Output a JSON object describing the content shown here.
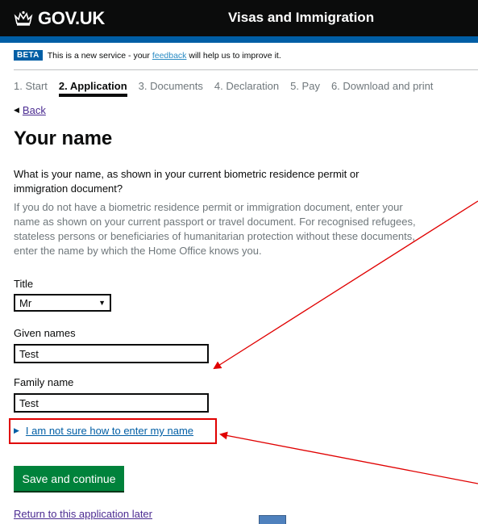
{
  "header": {
    "logo_text": "GOV.UK",
    "service_name": "Visas and Immigration"
  },
  "beta_banner": {
    "tag": "BETA",
    "text_before": "This is a new service - your ",
    "link": "feedback",
    "text_after": " will help us to improve it."
  },
  "steps": [
    {
      "label": "1. Start",
      "active": false
    },
    {
      "label": "2. Application",
      "active": true
    },
    {
      "label": "3. Documents",
      "active": false
    },
    {
      "label": "4. Declaration",
      "active": false
    },
    {
      "label": "5. Pay",
      "active": false
    },
    {
      "label": "6. Download and print",
      "active": false
    }
  ],
  "back_link": "Back",
  "page_title": "Your name",
  "question": "What is your name, as shown in your current biometric residence permit or immigration document?",
  "hint": "If you do not have a biometric residence permit or immigration document, enter your name as shown on your current passport or travel document. For recognised refugees, stateless persons or beneficiaries of humanitarian protection without these documents, enter the name by which the Home Office knows you.",
  "form": {
    "title_label": "Title",
    "title_value": "Mr",
    "given_names_label": "Given names",
    "given_names_value": "Test",
    "family_name_label": "Family name",
    "family_name_value": "Test"
  },
  "details_link": "I am not sure how to enter my name",
  "save_button": "Save and continue",
  "return_link": "Return to this application later",
  "colors": {
    "header_bg": "#0b0c0c",
    "header_blue": "#005ea5",
    "button_green": "#00823b",
    "annotation_red": "#e00000",
    "link_visited": "#4c2c92"
  }
}
